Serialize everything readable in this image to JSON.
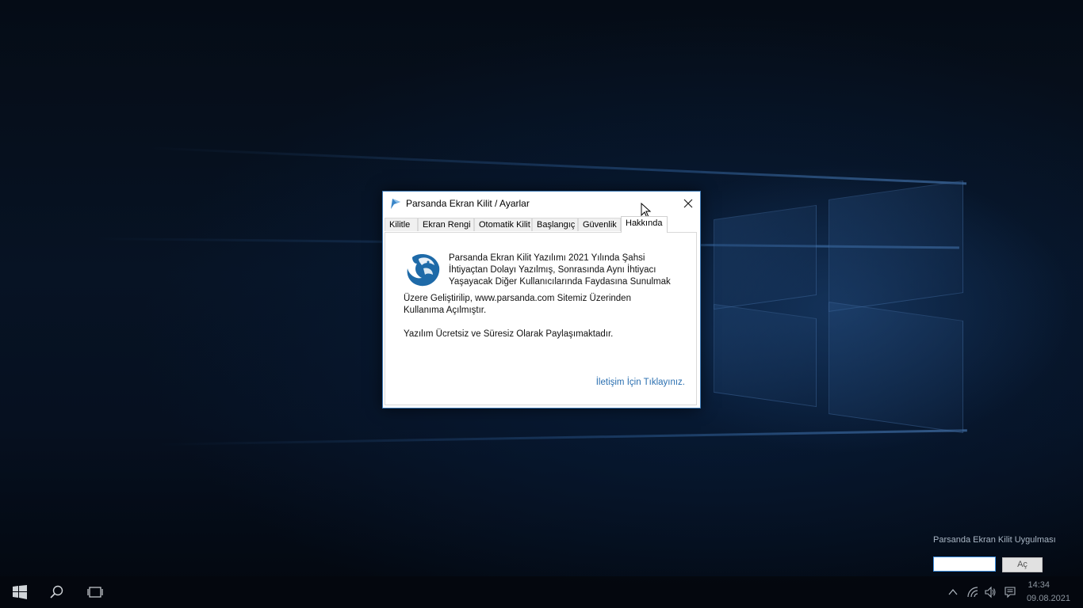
{
  "window": {
    "title": "Parsanda Ekran Kilit / Ayarlar"
  },
  "tabs": [
    {
      "label": "Kilitle"
    },
    {
      "label": "Ekran Rengi"
    },
    {
      "label": "Otomatik Kilit"
    },
    {
      "label": "Başlangıç"
    },
    {
      "label": "Güvenlik"
    },
    {
      "label": "Hakkında"
    }
  ],
  "active_tab": "Hakkında",
  "about": {
    "line1": "Parsanda Ekran Kilit Yazılımı 2021 Yılında Şahsi",
    "line2": "İhtiyaçtan Dolayı Yazılmış, Sonrasında Aynı İhtiyacı",
    "line3": "Yaşayacak Diğer Kullanıcılarında Faydasına Sunulmak",
    "line4": "Üzere Geliştirilip, www.parsanda.com Sitemiz Üzerinden",
    "line5": "Kullanıma Açılmıştır.",
    "free_text": "Yazılım Ücretsiz ve Süresiz Olarak Paylaşımaktadır.",
    "contact_link": "İletişim İçin Tıklayınız."
  },
  "widget": {
    "label": "Parsanda Ekran Kilit Uygulması",
    "password_value": "",
    "open_button": "Aç"
  },
  "taskbar": {
    "time": "14:34",
    "date": "09.08.2021"
  },
  "colors": {
    "accent": "#3c78b4",
    "link": "#2a6fb0",
    "logo": "#1e6aa8"
  },
  "icons": [
    "windows-start-icon",
    "search-icon",
    "task-view-icon",
    "chevron-up-icon",
    "network-icon",
    "volume-icon",
    "notification-icon",
    "close-icon",
    "app-logo-icon"
  ]
}
